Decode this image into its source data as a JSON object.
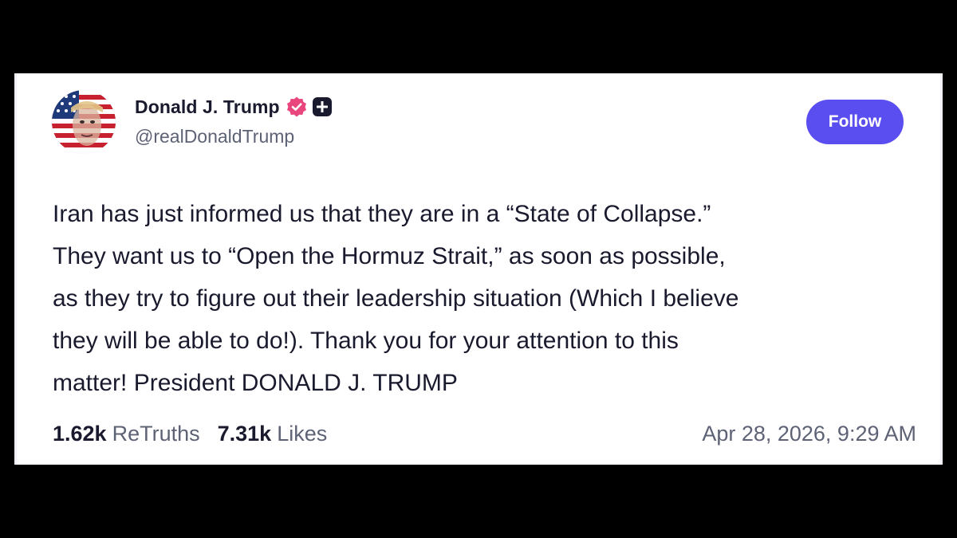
{
  "post": {
    "author": {
      "display_name": "Donald J. Trump",
      "handle": "@realDonaldTrump",
      "avatar_icon": "avatar-flag-portrait",
      "verified_icon": "verified-badge-icon",
      "verified_color": "#e8467c",
      "plus_icon": "plus-badge-icon"
    },
    "follow_label": "Follow",
    "body_lines": [
      "Iran has just informed us that they are in a “State of Collapse.”",
      "They want us to “Open the Hormuz Strait,” as soon as possible,",
      "as they try to figure out their leadership situation (Which I believe",
      "they will be able to do!). Thank you for your attention to this",
      "matter! President DONALD J. TRUMP"
    ],
    "stats": {
      "retruths_count": "1.62k",
      "retruths_label": "ReTruths",
      "likes_count": "7.31k",
      "likes_label": "Likes"
    },
    "timestamp": "Apr 28, 2026, 9:29 AM"
  },
  "colors": {
    "accent": "#5b4ef0",
    "text_primary": "#1a1a2e",
    "text_secondary": "#5d6275",
    "background": "#000000",
    "card": "#ffffff"
  }
}
